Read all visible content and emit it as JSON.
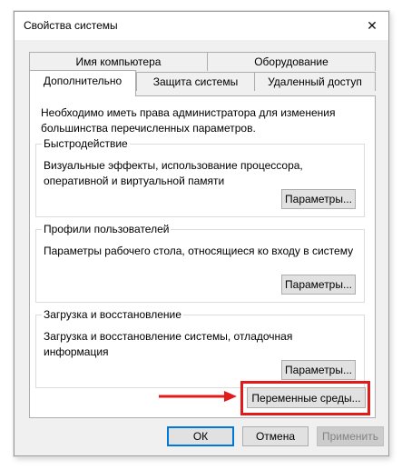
{
  "window": {
    "title": "Свойства системы",
    "close_glyph": "✕"
  },
  "tabs": {
    "top_row": [
      {
        "label": "Имя компьютера"
      },
      {
        "label": "Оборудование"
      }
    ],
    "bottom_row": [
      {
        "label": "Дополнительно",
        "active": true
      },
      {
        "label": "Защита системы"
      },
      {
        "label": "Удаленный доступ"
      }
    ]
  },
  "panel": {
    "intro": "Необходимо иметь права администратора для изменения большинства перечисленных параметров.",
    "groups": [
      {
        "title": "Быстродействие",
        "description": "Визуальные эффекты, использование процессора, оперативной и виртуальной памяти",
        "button": "Параметры..."
      },
      {
        "title": "Профили пользователей",
        "description": "Параметры рабочего стола, относящиеся ко входу в систему",
        "button": "Параметры..."
      },
      {
        "title": "Загрузка и восстановление",
        "description": "Загрузка и восстановление системы, отладочная информация",
        "button": "Параметры..."
      }
    ],
    "env_button": "Переменные среды..."
  },
  "footer": {
    "ok": "ОК",
    "cancel": "Отмена",
    "apply": "Применить"
  },
  "colors": {
    "highlight": "#e11b1b",
    "focus_border": "#0078d7"
  }
}
